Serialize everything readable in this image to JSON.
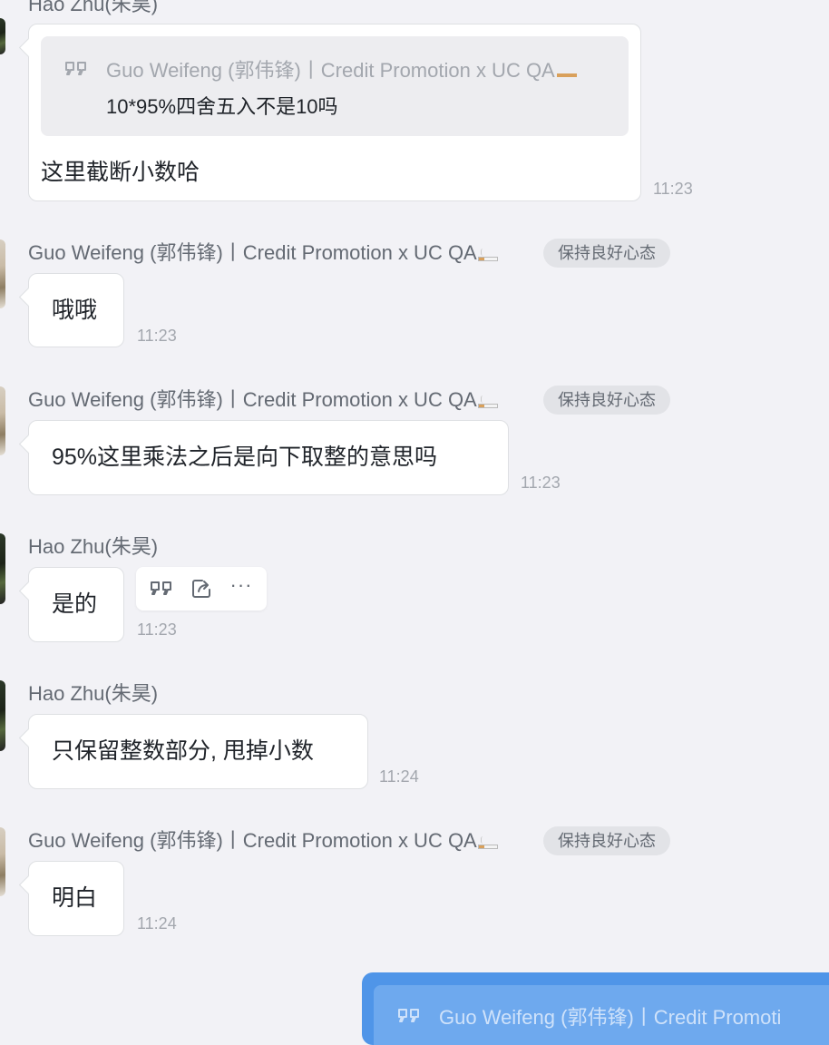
{
  "colors": {
    "background": "#f2f2f6",
    "bubble": "#ffffff",
    "bubble_border": "#dee0e3",
    "sender_text": "#646a73",
    "time_text": "#a3a7ae",
    "outgoing_bubble": "#4f95e8"
  },
  "messages": [
    {
      "sender": "Hao Zhu(朱昊)",
      "quote_sender": "Guo Weifeng (郭伟锋)丨Credit Promotion x UC QA",
      "quote_text": "10*95%四舍五入不是10吗",
      "text": "这里截断小数哈",
      "time": "11:23"
    },
    {
      "sender": "Guo Weifeng (郭伟锋)丨Credit Promotion x UC QA",
      "status": "保持良好心态",
      "text": "哦哦",
      "time": "11:23"
    },
    {
      "sender": "Guo Weifeng (郭伟锋)丨Credit Promotion x UC QA",
      "status": "保持良好心态",
      "text": "95%这里乘法之后是向下取整的意思吗",
      "time": "11:23"
    },
    {
      "sender": "Hao Zhu(朱昊)",
      "text": "是的",
      "time": "11:23"
    },
    {
      "sender": "Hao Zhu(朱昊)",
      "text": "只保留整数部分, 甩掉小数",
      "time": "11:24"
    },
    {
      "sender": "Guo Weifeng (郭伟锋)丨Credit Promotion x UC QA",
      "status": "保持良好心态",
      "text": "明白",
      "time": "11:24"
    }
  ],
  "hover_toolbar": {
    "icons": [
      "quote-reply-icon",
      "forward-icon",
      "more-icon"
    ],
    "more_label": "···"
  },
  "outgoing": {
    "quote_sender": "Guo Weifeng (郭伟锋)丨Credit Promoti"
  }
}
